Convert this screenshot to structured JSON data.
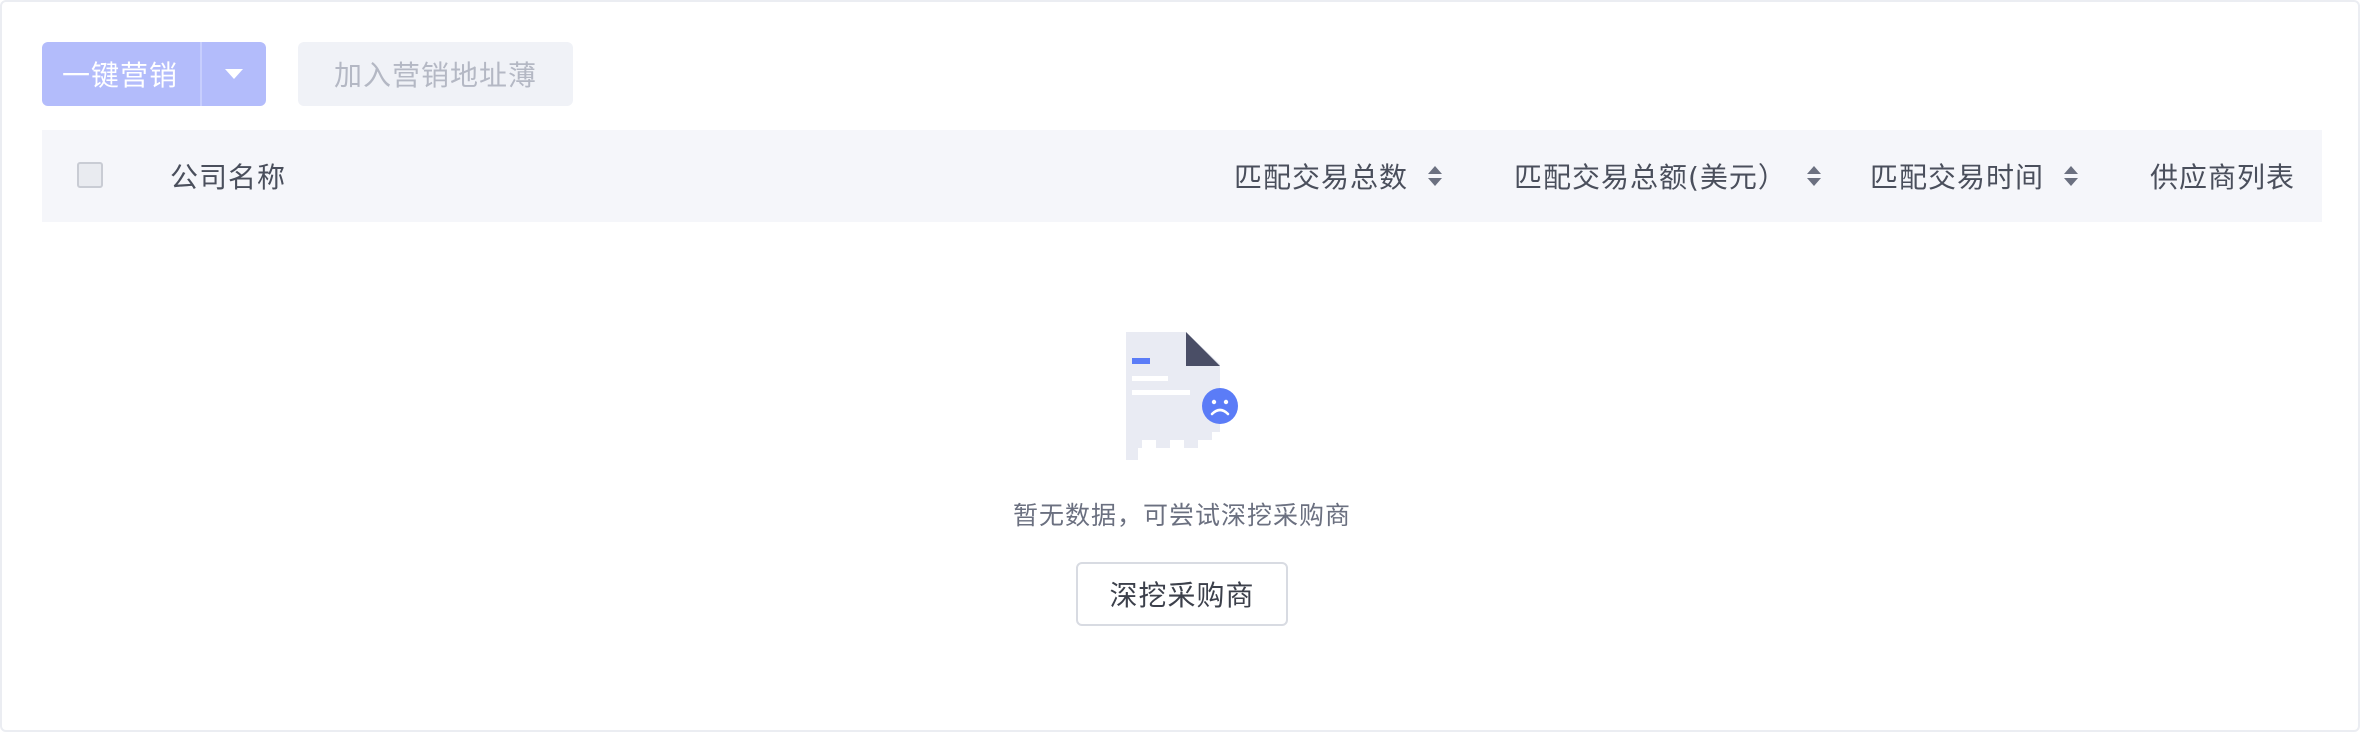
{
  "toolbar": {
    "primary_label": "一键营销",
    "dropdown_icon": "caret-down-icon",
    "secondary_label": "加入营销地址薄"
  },
  "table": {
    "columns": {
      "company": "公司名称",
      "match_count": "匹配交易总数",
      "match_amount": "匹配交易总额(美元）",
      "match_time": "匹配交易时间",
      "supplier_list": "供应商列表"
    },
    "sort_icon": "sort-icon",
    "rows": []
  },
  "empty_state": {
    "illustration": "empty-document-sad-icon",
    "message": "暂无数据，可尝试深挖采购商",
    "action_label": "深挖采购商"
  },
  "colors": {
    "primary_disabled": "#b3bcfb",
    "accent": "#5b7cf7",
    "header_bg": "#f5f6fa",
    "text": "#4a4f5c"
  }
}
